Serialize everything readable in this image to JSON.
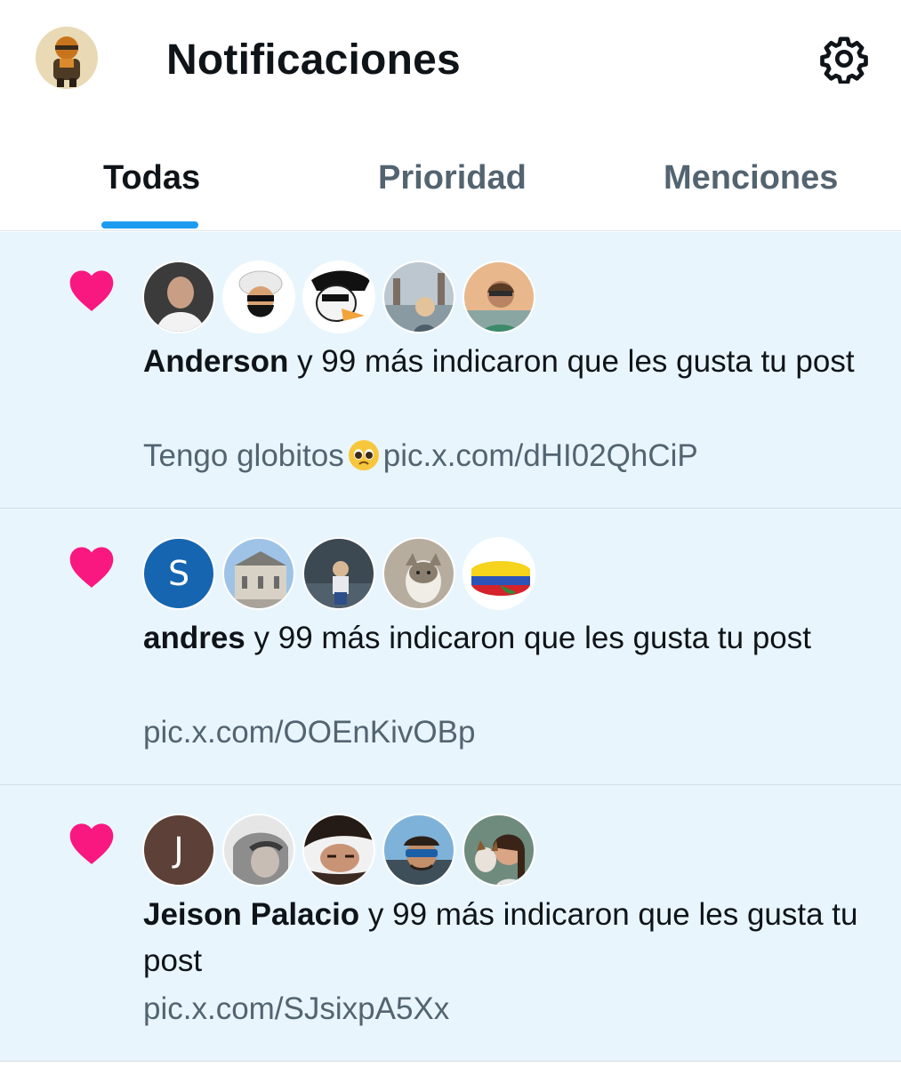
{
  "header": {
    "title": "Notificaciones",
    "avatar_icon": "profile-avatar",
    "settings_icon": "gear-icon"
  },
  "tabs": [
    {
      "label": "Todas",
      "active": true
    },
    {
      "label": "Prioridad",
      "active": false
    },
    {
      "label": "Menciones",
      "active": false
    }
  ],
  "notifications": [
    {
      "icon": "heart-icon",
      "user": "Anderson",
      "action": " y 99 más indicaron que les gusta tu post",
      "post_text": "Tengo globitos",
      "post_emoji": "pleading-face",
      "link": "pic.x.com/dHI02QhCiP"
    },
    {
      "icon": "heart-icon",
      "user": "andres",
      "action": " y 99 más indicaron que les gusta tu post",
      "avatar_letter": "S",
      "link": "pic.x.com/OOEnKivOBp"
    },
    {
      "icon": "heart-icon",
      "user": "Jeison Palacio",
      "action": " y 99 más indicaron que les gusta tu post",
      "avatar_letter": "J",
      "link": "pic.x.com/SJsixpA5Xx"
    }
  ],
  "colors": {
    "accent": "#1d9bf0",
    "heart": "#f91880",
    "unread_bg": "#e8f5fd",
    "muted_text": "#536471"
  }
}
